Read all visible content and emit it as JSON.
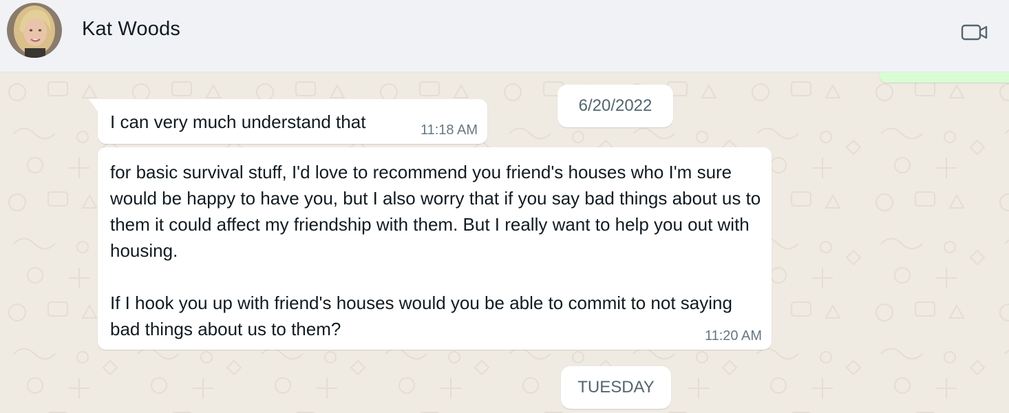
{
  "header": {
    "contact_name": "Kat Woods",
    "avatar_icon": "contact-avatar",
    "video_icon": "video-camera-icon"
  },
  "chat": {
    "date_separators": [
      "6/20/2022",
      "TUESDAY"
    ],
    "messages": [
      {
        "direction": "incoming",
        "text": "I can very much understand that",
        "time": "11:18 AM"
      },
      {
        "direction": "incoming",
        "text": "for basic survival stuff, I'd love to recommend you friend's houses who I'm sure would be happy to have you, but I also worry that if you say bad things about us to them it could affect my friendship with them. But I really want to help you out with housing.\n\nIf I hook you up with friend's houses would you be able to commit to not saying bad things about us to them?",
        "time": "11:20 AM"
      }
    ]
  },
  "colors": {
    "header_bg": "#f0f2f5",
    "chat_bg": "#efeae2",
    "incoming_bubble": "#ffffff",
    "outgoing_bubble": "#d9fdd3",
    "timestamp": "#667781"
  }
}
